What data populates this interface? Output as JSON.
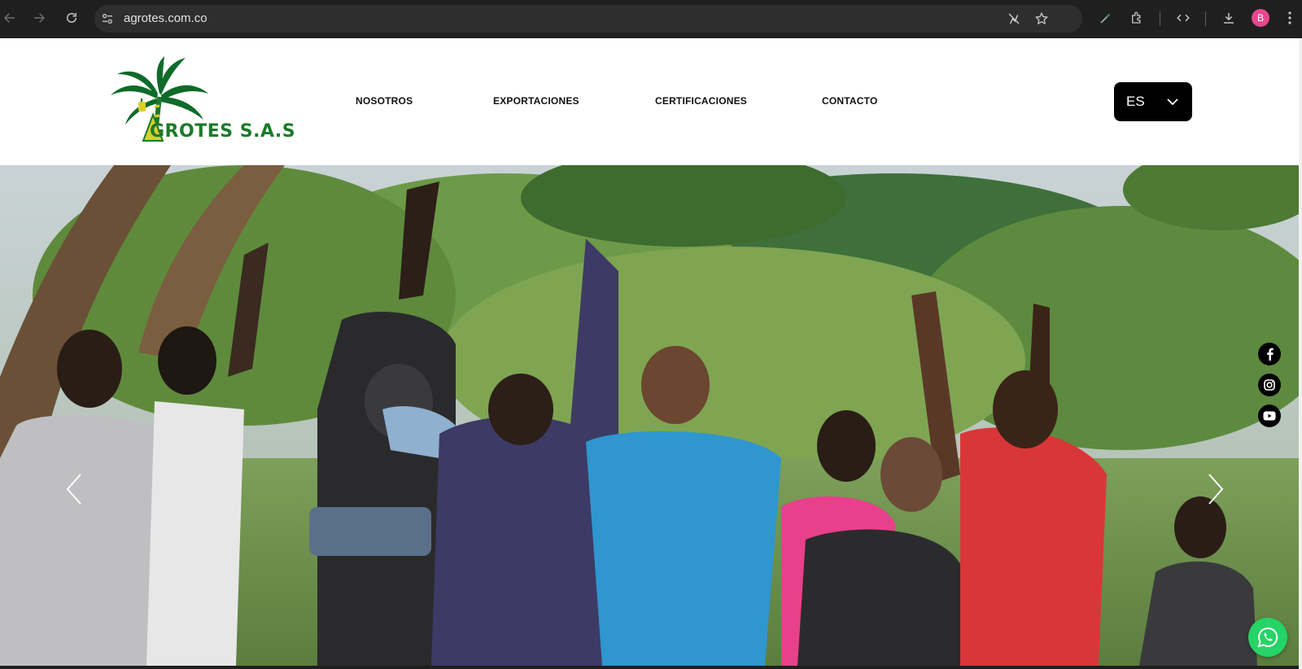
{
  "browser": {
    "url": "agrotes.com.co",
    "profile_initial": "B"
  },
  "header": {
    "logo_text": "GROTES S.A.S",
    "nav": [
      "NOSOTROS",
      "EXPORTACIONES",
      "CERTIFICACIONES",
      "CONTACTO"
    ],
    "language": "ES"
  },
  "hero": {
    "image_description_icon": "photo-celebrating-workers",
    "prev_icon": "chevron-left-icon",
    "next_icon": "chevron-right-icon"
  },
  "social": [
    "facebook-icon",
    "instagram-icon",
    "youtube-icon"
  ],
  "colors": {
    "brand_green": "#1b7a2a",
    "logo_yellow": "#d9cf2a",
    "whatsapp": "#25d366"
  }
}
